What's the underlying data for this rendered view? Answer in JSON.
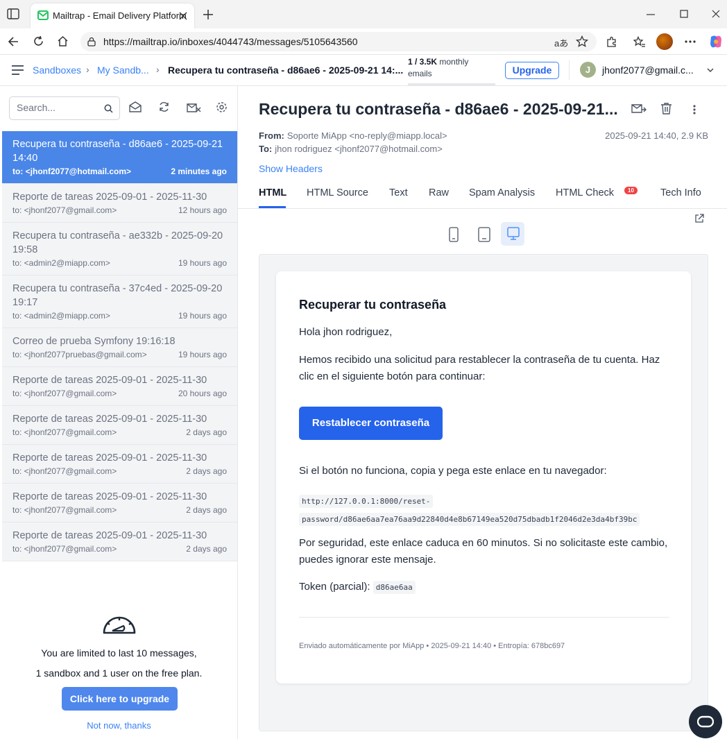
{
  "browser": {
    "tab_title": "Mailtrap - Email Delivery Platform",
    "url": "https://mailtrap.io/inboxes/4044743/messages/5105643560"
  },
  "app": {
    "breadcrumb": [
      "Sandboxes",
      "My Sandb...",
      "Recupera tu contraseña - d86ae6 - 2025-09-21 14:..."
    ],
    "quota_count": "1 / 3.5K",
    "quota_label": "monthly emails",
    "quota_fraction": 0.0003,
    "upgrade_label": "Upgrade",
    "avatar_initial": "J",
    "user_email": "jhonf2077@gmail.c..."
  },
  "sidebar": {
    "search_placeholder": "Search...",
    "messages": [
      {
        "subject": "Recupera tu contraseña - d86ae6 - 2025-09-21 14:40",
        "to": "to: <jhonf2077@hotmail.com>",
        "time": "2 minutes ago",
        "selected": true
      },
      {
        "subject": "Reporte de tareas 2025-09-01 - 2025-11-30",
        "to": "to: <jhonf2077@gmail.com>",
        "time": "12 hours ago"
      },
      {
        "subject": "Recupera tu contraseña - ae332b - 2025-09-20 19:58",
        "to": "to: <admin2@miapp.com>",
        "time": "19 hours ago"
      },
      {
        "subject": "Recupera tu contraseña - 37c4ed - 2025-09-20 19:17",
        "to": "to: <admin2@miapp.com>",
        "time": "19 hours ago"
      },
      {
        "subject": "Correo de prueba Symfony 19:16:18",
        "to": "to: <jhonf2077pruebas@gmail.com>",
        "time": "19 hours ago"
      },
      {
        "subject": "Reporte de tareas 2025-09-01 - 2025-11-30",
        "to": "to: <jhonf2077@gmail.com>",
        "time": "20 hours ago"
      },
      {
        "subject": "Reporte de tareas 2025-09-01 - 2025-11-30",
        "to": "to: <jhonf2077@gmail.com>",
        "time": "2 days ago"
      },
      {
        "subject": "Reporte de tareas 2025-09-01 - 2025-11-30",
        "to": "to: <jhonf2077@gmail.com>",
        "time": "2 days ago"
      },
      {
        "subject": "Reporte de tareas 2025-09-01 - 2025-11-30",
        "to": "to: <jhonf2077@gmail.com>",
        "time": "2 days ago"
      },
      {
        "subject": "Reporte de tareas 2025-09-01 - 2025-11-30",
        "to": "to: <jhonf2077@gmail.com>",
        "time": "2 days ago"
      }
    ],
    "limit_line1": "You are limited to last 10 messages,",
    "limit_line2": "1 sandbox and 1 user on the free plan.",
    "cta": "Click here to upgrade",
    "not_now": "Not now, thanks"
  },
  "message": {
    "subject": "Recupera tu contraseña - d86ae6 - 2025-09-21...",
    "from_label": "From:",
    "from": "Soporte MiApp <no-reply@miapp.local>",
    "to_label": "To:",
    "to": "jhon rodriguez <jhonf2077@hotmail.com>",
    "date_size": "2025-09-21 14:40, 2.9 KB",
    "show_headers": "Show Headers",
    "tabs": [
      "HTML",
      "HTML Source",
      "Text",
      "Raw",
      "Spam Analysis",
      "HTML Check",
      "Tech Info"
    ],
    "html_check_badge": "10"
  },
  "email": {
    "heading": "Recuperar tu contraseña",
    "greeting": "Hola jhon rodriguez,",
    "body1": "Hemos recibido una solicitud para restablecer la contraseña de tu cuenta. Haz clic en el siguiente botón para continuar:",
    "button": "Restablecer contraseña",
    "fallback": "Si el botón no funciona, copia y pega este enlace en tu navegador:",
    "link_part1": "http://127.0.0.1:8000/reset-",
    "link_part2": "password/d86ae6aa7ea76aa9d22840d4e8b67149ea520d75dbadb1f2046d2e3da4bf39bc",
    "security": "Por seguridad, este enlace caduca en 60 minutos. Si no solicitaste este cambio, puedes ignorar este mensaje.",
    "token_label": "Token (parcial):",
    "token": "d86ae6aa",
    "footer": "Enviado automáticamente por MiApp • 2025-09-21 14:40 • Entropía: 678bc697"
  },
  "colors": {
    "accent": "#2563eb",
    "selected_row": "#4a86e8",
    "badge": "#ef4444"
  }
}
